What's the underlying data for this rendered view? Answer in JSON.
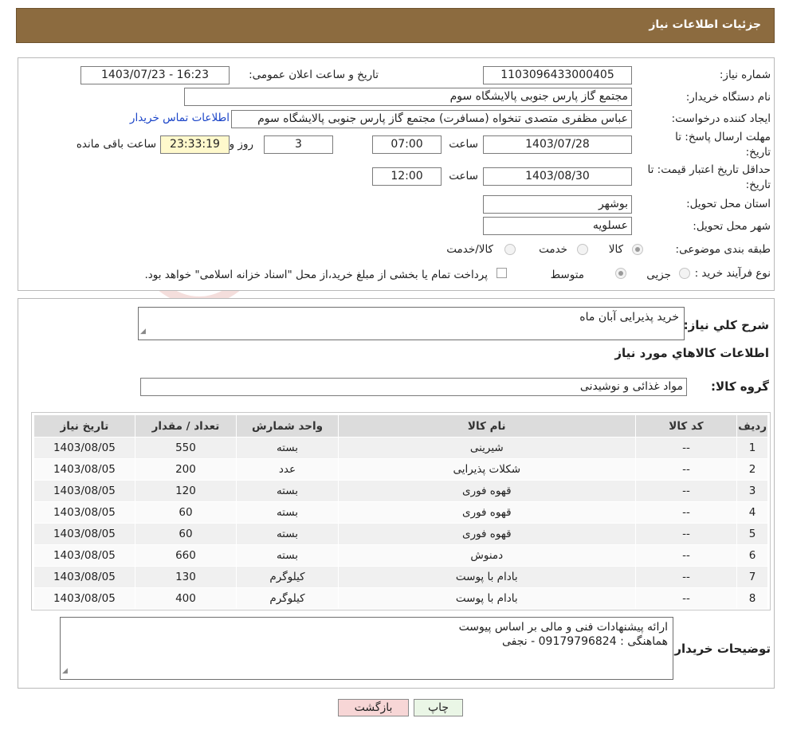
{
  "header": {
    "title": "جزئیات اطلاعات نیاز"
  },
  "form": {
    "need_number": {
      "label": "شماره نیاز:",
      "value": "1103096433000405"
    },
    "announce_dt": {
      "label": "تاریخ و ساعت اعلان عمومی:",
      "value": "1403/07/23 - 16:23"
    },
    "buyer_org": {
      "label": "نام دستگاه خریدار:",
      "value": "مجتمع گاز پارس جنوبی  پالایشگاه سوم"
    },
    "requester": {
      "label": "ایجاد کننده درخواست:",
      "value": "عباس مظفری متصدی تنخواه (مسافرت) مجتمع گاز پارس جنوبی  پالایشگاه سوم",
      "contact_link": "اطلاعات تماس خریدار"
    },
    "reply_deadline": {
      "label_line1": "مهلت ارسال پاسخ: تا",
      "label_line2": "تاریخ:",
      "date": "1403/07/28",
      "time_label": "ساعت",
      "time": "07:00",
      "days": "3",
      "days_label": "روز و",
      "remaining": "23:33:19",
      "remaining_label": "ساعت باقی مانده"
    },
    "price_validity": {
      "label_line1": "حداقل تاریخ اعتبار قیمت: تا",
      "label_line2": "تاریخ:",
      "date": "1403/08/30",
      "time_label": "ساعت",
      "time": "12:00"
    },
    "province": {
      "label": "استان محل تحویل:",
      "value": "بوشهر"
    },
    "city": {
      "label": "شهر محل تحویل:",
      "value": "عسلویه"
    },
    "category": {
      "label": "طبقه بندی موضوعی:",
      "options": [
        "کالا",
        "خدمت",
        "کالا/خدمت"
      ]
    },
    "process": {
      "label": "نوع فرآیند خرید :",
      "options": [
        "جزیی",
        "متوسط"
      ],
      "note": "پرداخت تمام یا بخشی از مبلغ خرید،از محل \"اسناد خزانه اسلامی\" خواهد بود."
    }
  },
  "summary": {
    "label": "شرح كلي نياز:",
    "value": "خرید پذیرایی آبان ماه"
  },
  "items_title": "اطلاعات كالاهاي مورد نياز",
  "goods_group": {
    "label": "گروه كالا:",
    "value": "مواد غذائی و نوشیدنی"
  },
  "table": {
    "headers": [
      "ردیف",
      "کد کالا",
      "نام کالا",
      "واحد شمارش",
      "تعداد / مقدار",
      "تاریخ نیاز"
    ],
    "rows": [
      [
        "1",
        "--",
        "شیرینی",
        "بسته",
        "550",
        "1403/08/05"
      ],
      [
        "2",
        "--",
        "شکلات پذیرایی",
        "عدد",
        "200",
        "1403/08/05"
      ],
      [
        "3",
        "--",
        "قهوه فوری",
        "بسته",
        "120",
        "1403/08/05"
      ],
      [
        "4",
        "--",
        "قهوه فوری",
        "بسته",
        "60",
        "1403/08/05"
      ],
      [
        "5",
        "--",
        "قهوه فوری",
        "بسته",
        "60",
        "1403/08/05"
      ],
      [
        "6",
        "--",
        "دمنوش",
        "بسته",
        "660",
        "1403/08/05"
      ],
      [
        "7",
        "--",
        "بادام با پوست",
        "کیلوگرم",
        "130",
        "1403/08/05"
      ],
      [
        "8",
        "--",
        "بادام با پوست",
        "کیلوگرم",
        "400",
        "1403/08/05"
      ]
    ]
  },
  "buyer_notes": {
    "label": "توضیحات خریدار:",
    "line1": "ارائه پیشنهادات فنی و مالی بر اساس پیوست",
    "line2": "هماهنگی : 09179796824 - نجفی"
  },
  "buttons": {
    "print": "چاپ",
    "back": "بازگشت"
  },
  "watermark": {
    "text": "AriaTender.neT"
  },
  "colors": {
    "header_bg": "#8c6b3f",
    "remaining_bg": "#fff9cc",
    "back_btn_bg": "#f7d6d6",
    "print_btn_bg": "#eaf6e6",
    "link": "#1a44c8"
  }
}
